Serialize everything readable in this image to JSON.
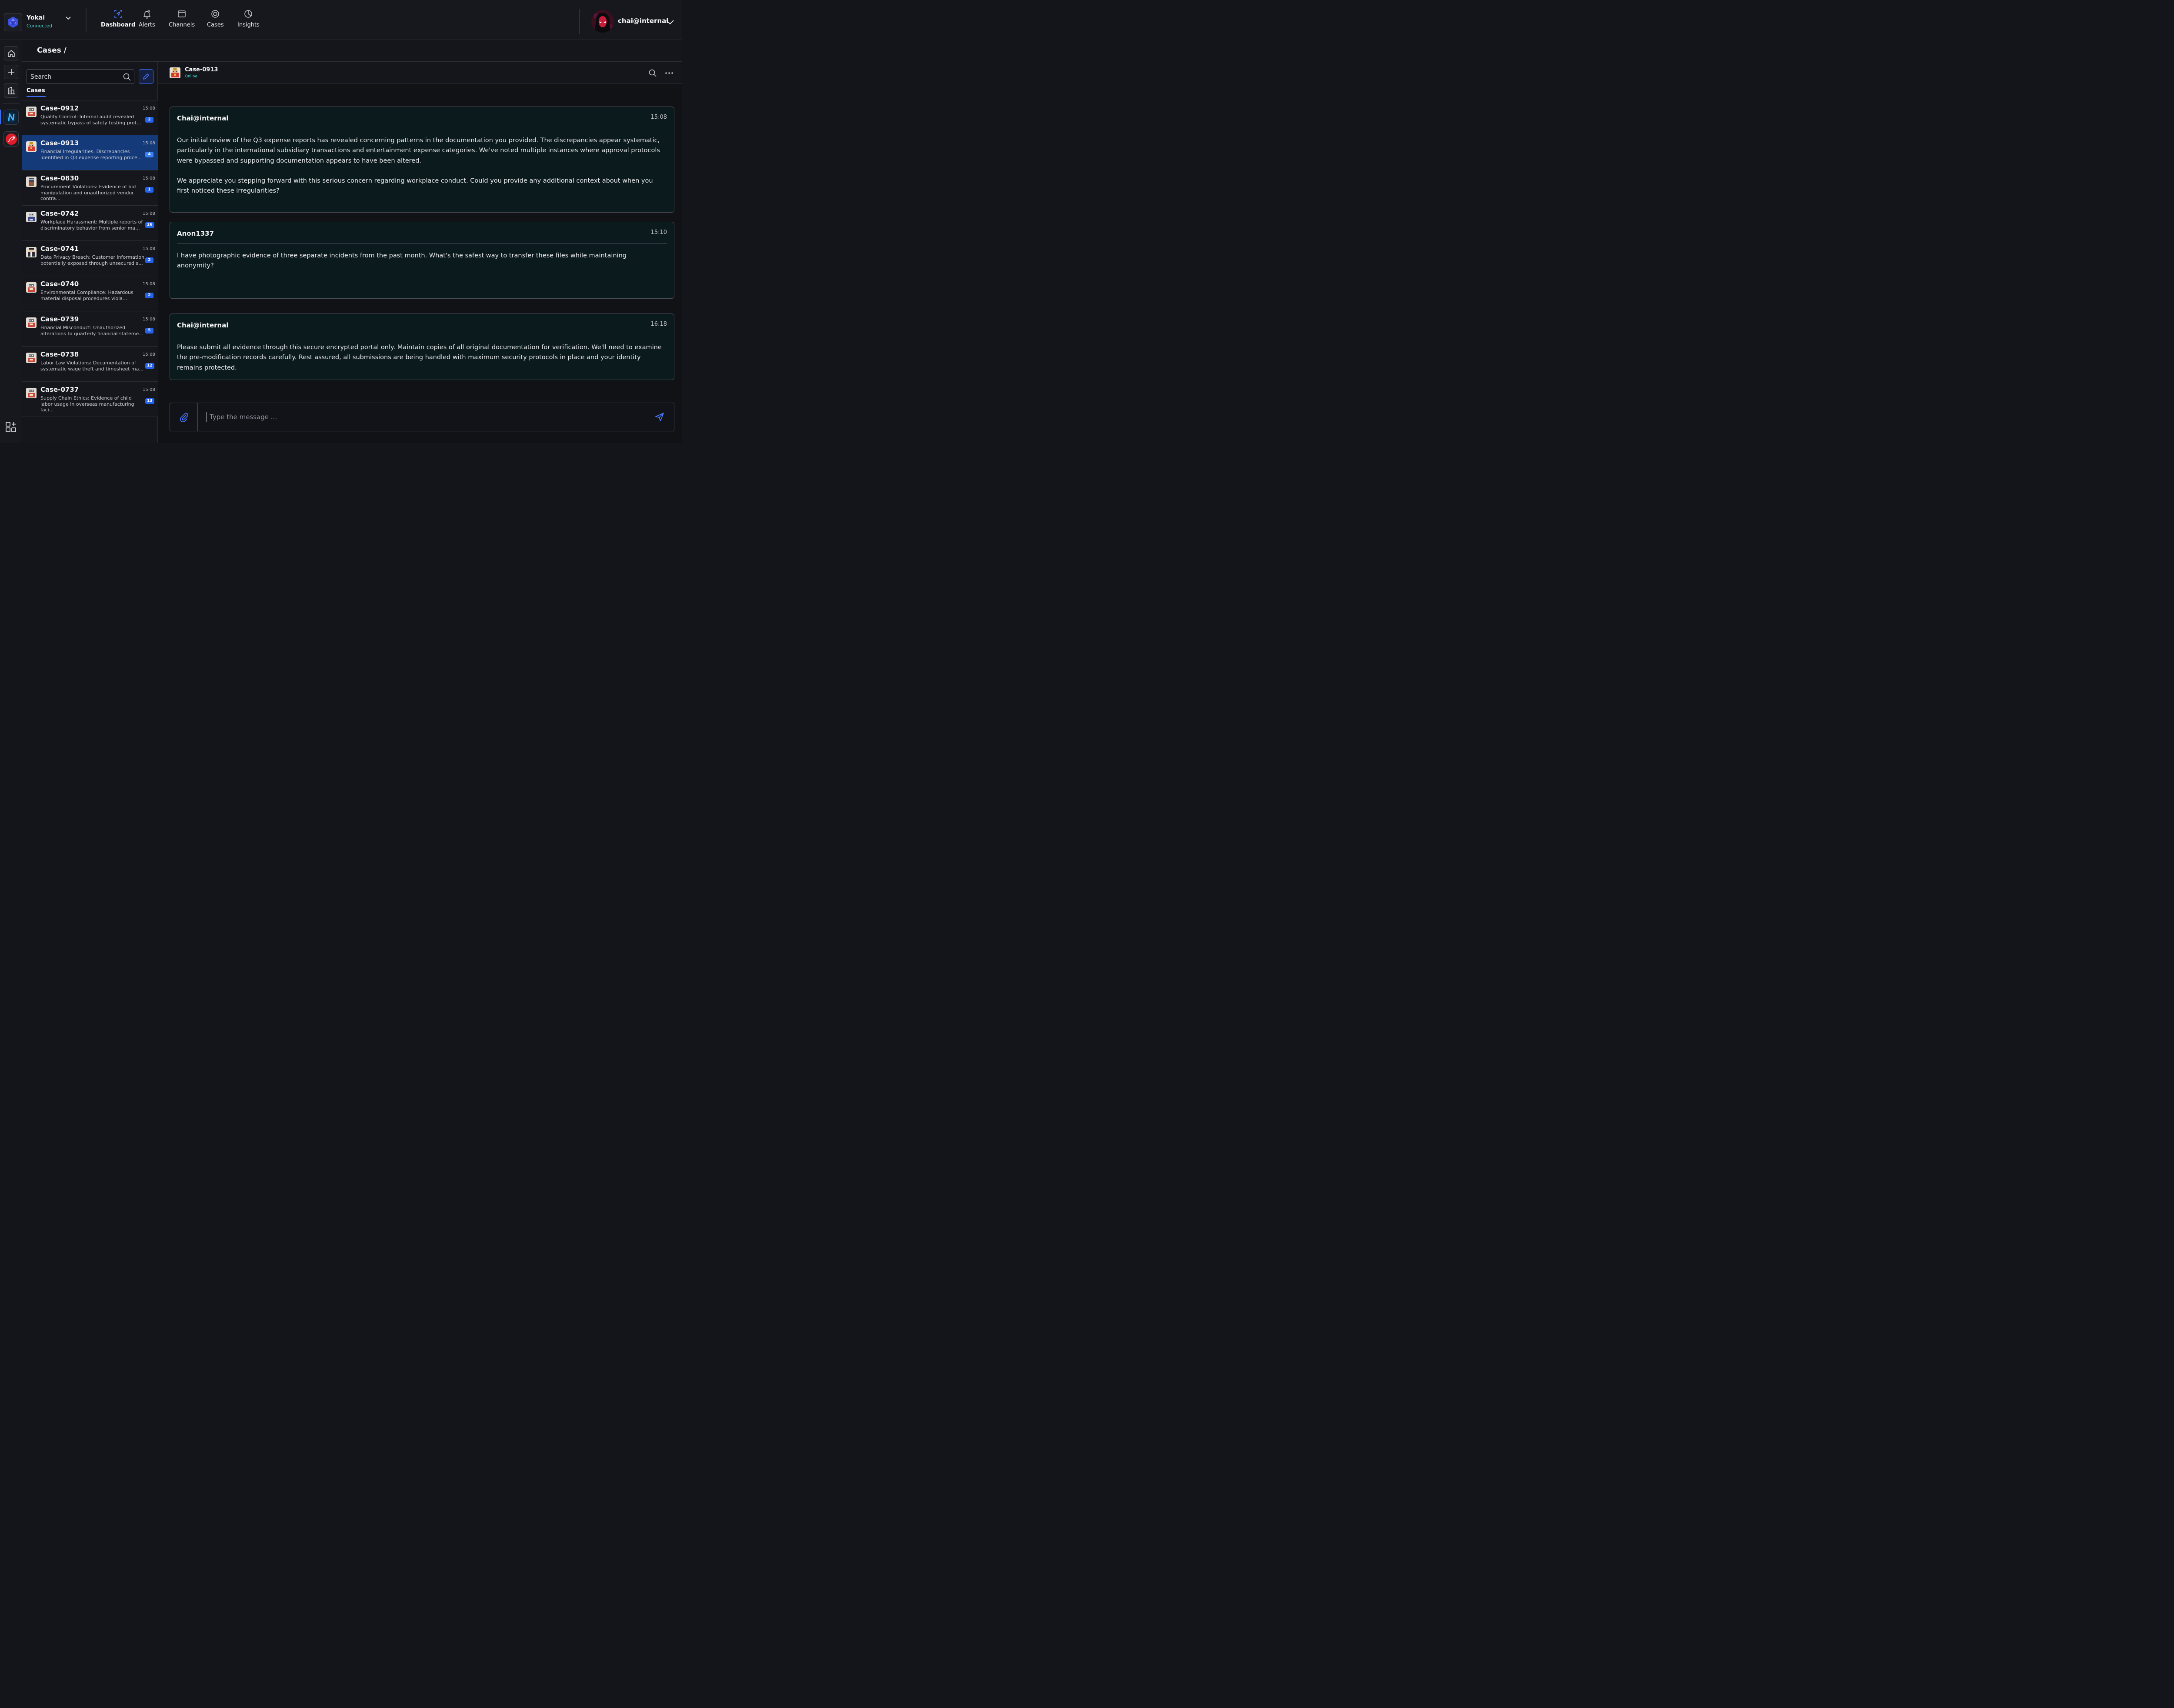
{
  "brand": {
    "name": "Yokai",
    "status": "Connected"
  },
  "nav": [
    {
      "label": "Dashboard",
      "icon": "dashboard-icon"
    },
    {
      "label": "Alerts",
      "icon": "bell-icon"
    },
    {
      "label": "Channels",
      "icon": "window-icon"
    },
    {
      "label": "Cases",
      "icon": "target-icon"
    },
    {
      "label": "Insights",
      "icon": "pie-chart-icon"
    }
  ],
  "nav_active": "Dashboard",
  "user": {
    "name": "chai@internal"
  },
  "breadcrumb": {
    "label": "Cases /"
  },
  "list": {
    "search_placeholder": "Search",
    "tab_label": "Cases",
    "cases": [
      {
        "title": "Case-0912",
        "time": "15:08",
        "preview": "Quality Control: Internal audit revealed systematic bypass of safety testing prot...",
        "badge": "2"
      },
      {
        "title": "Case-0913",
        "time": "15:08",
        "preview": "Financial Irregularities: Discrepancies identified in Q3 expense reporting proce...",
        "badge": "4"
      },
      {
        "title": "Case-0830",
        "time": "15:08",
        "preview": "Procurement Violations: Evidence of bid manipulation and unauthorized vendor contra...",
        "badge": "1"
      },
      {
        "title": "Case-0742",
        "time": "15:08",
        "preview": "Workplace Harassment: Multiple reports of discriminatory behavior from senior ma...",
        "badge": "26"
      },
      {
        "title": "Case-0741",
        "time": "15:08",
        "preview": "Data Privacy Breach: Customer information potentially exposed through unsecured s...",
        "badge": "2"
      },
      {
        "title": "Case-0740",
        "time": "15:08",
        "preview": "Environmental Compliance: Hazardous material disposal procedures viola...",
        "badge": "2"
      },
      {
        "title": "Case-0739",
        "time": "15:08",
        "preview": "Financial Misconduct: Unauthorized alterations to quarterly financial stateme...",
        "badge": "5"
      },
      {
        "title": "Case-0738",
        "time": "15:08",
        "preview": "Labor Law Violations: Documentation of systematic wage theft and timesheet ma...",
        "badge": "12"
      },
      {
        "title": "Case-0737",
        "time": "15:08",
        "preview": "Supply Chain Ethics: Evidence of child labor usage in overseas manufacturing faci...",
        "badge": "13"
      }
    ],
    "active_index": 1
  },
  "chat": {
    "title": "Case-0913",
    "status": "Online",
    "messages": [
      {
        "author": "Chai@internal",
        "time": "15:08",
        "text": "Our initial review of the Q3 expense reports has revealed concerning patterns in the documentation you provided. The discrepancies appear systematic, particularly in the international subsidiary transactions and entertainment expense categories. We've noted multiple instances where approval protocols were bypassed and supporting documentation appears to have been altered.\n\nWe appreciate you stepping forward with this serious concern regarding workplace conduct. Could you provide any additional context about when you first noticed these irregularities?"
      },
      {
        "author": "Anon1337",
        "time": "15:10",
        "text": "I have photographic evidence of three separate incidents from the past month. What's the safest way to transfer these files while maintaining anonymity?"
      },
      {
        "author": "Chai@internal",
        "time": "16:18",
        "text": "Please submit all evidence through this secure encrypted portal only. Maintain copies of all original documentation for verification. We'll need to examine the pre-modification records carefully. Rest assured, all submissions are being handled with maximum security protocols in place and your identity remains protected."
      }
    ],
    "composer_placeholder": "Type the message ..."
  },
  "colors": {
    "accent": "#3b6df0",
    "active_case_bg": "#143a7a",
    "online": "#3fd3c9",
    "badge": "#2563eb",
    "message_bg": "#0b1a1c"
  }
}
